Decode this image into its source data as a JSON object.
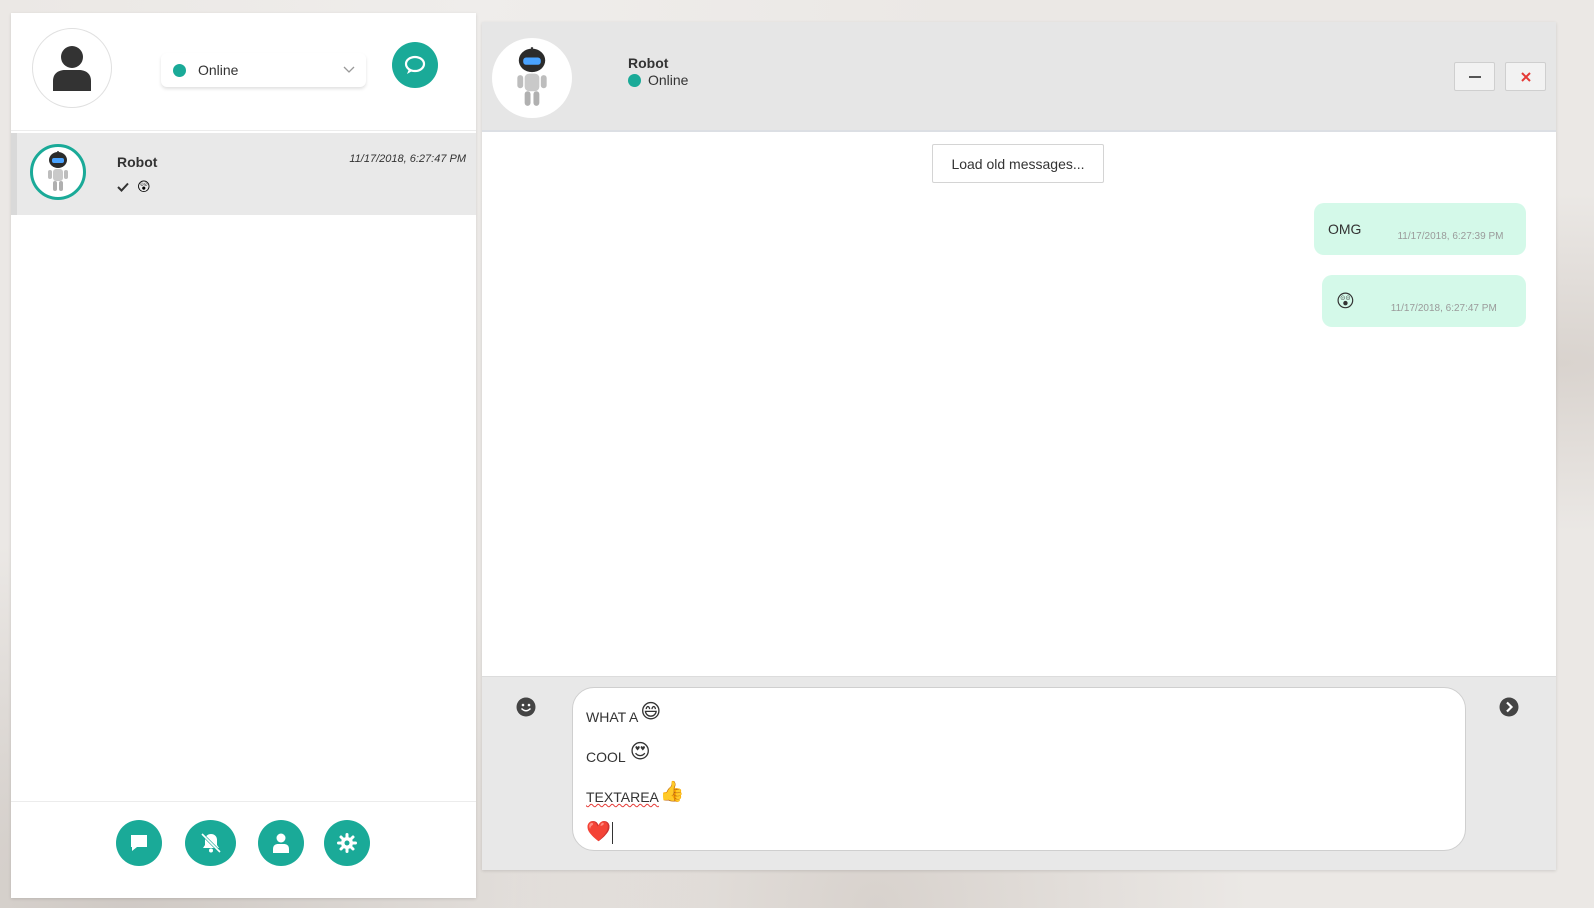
{
  "app": {
    "accent_color": "#1aaa98",
    "bubble_color": "#d4f9e9"
  },
  "sidebar": {
    "my_avatar_icon": "user-icon",
    "status_select": {
      "value": "Online",
      "status_color": "#1aaa98"
    },
    "new_chat_icon": "chat-bubble-icon",
    "conversations": [
      {
        "name": "Robot",
        "time": "11/17/2018, 6:27:47 PM",
        "preview_icon": "check-icon",
        "preview": "😲"
      }
    ],
    "footer_buttons": [
      {
        "icon": "message-icon"
      },
      {
        "icon": "bell-off-icon"
      },
      {
        "icon": "user-icon"
      },
      {
        "icon": "gear-icon"
      }
    ]
  },
  "chat": {
    "peer": {
      "name": "Robot",
      "status": "Online"
    },
    "window_controls": {
      "minimize_icon": "minimize-icon",
      "close_icon": "close-icon"
    },
    "load_old_label": "Load old messages...",
    "messages": [
      {
        "text": "OMG",
        "time": "11/17/2018, 6:27:39 PM"
      },
      {
        "text": "😲",
        "time": "11/17/2018, 6:27:47 PM"
      }
    ],
    "composer": {
      "emoji_icon": "smiley-icon",
      "send_icon": "send-arrow-icon",
      "lines": [
        {
          "text": "WHAT A",
          "emoji": "😄"
        },
        {
          "text": "COOL",
          "emoji": "😍"
        },
        {
          "text": "TEXTAREA",
          "emoji": "👍"
        },
        {
          "text": "",
          "emoji": "❤️"
        }
      ]
    }
  }
}
